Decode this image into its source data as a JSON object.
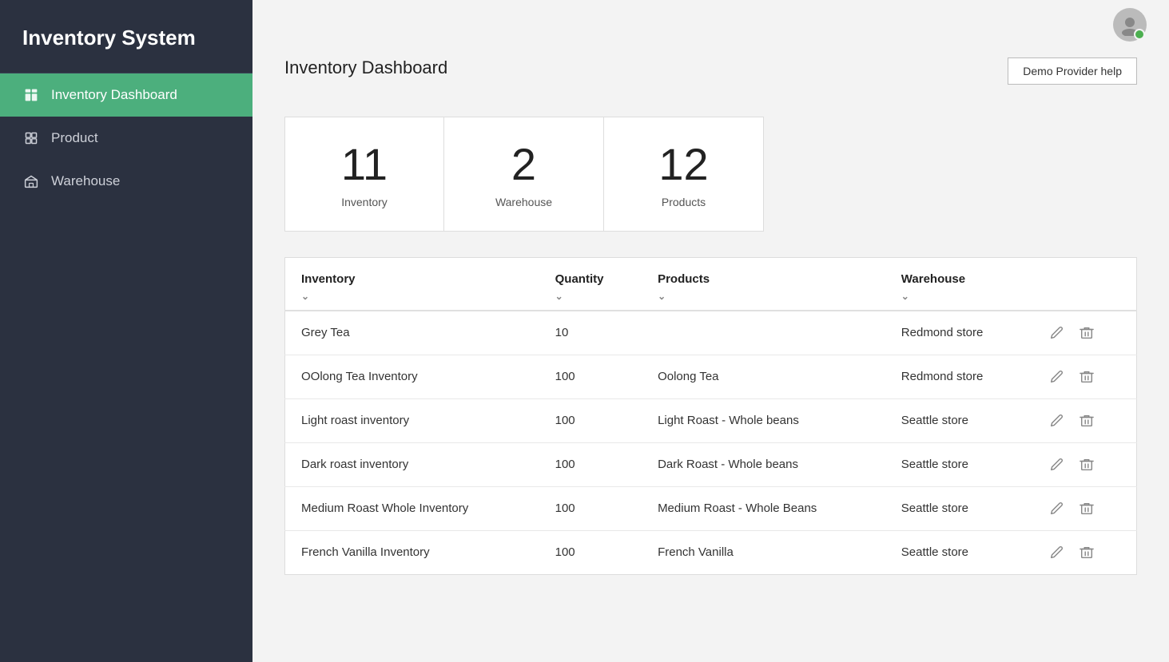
{
  "sidebar": {
    "title": "Inventory System",
    "items": [
      {
        "id": "inventory-dashboard",
        "label": "Inventory Dashboard",
        "icon": "dashboard-icon",
        "active": true
      },
      {
        "id": "product",
        "label": "Product",
        "icon": "product-icon",
        "active": false
      },
      {
        "id": "warehouse",
        "label": "Warehouse",
        "icon": "warehouse-icon",
        "active": false
      }
    ]
  },
  "header": {
    "page_title": "Inventory Dashboard",
    "demo_help_label": "Demo Provider help"
  },
  "stats": [
    {
      "number": "11",
      "label": "Inventory"
    },
    {
      "number": "2",
      "label": "Warehouse"
    },
    {
      "number": "12",
      "label": "Products"
    }
  ],
  "table": {
    "columns": [
      {
        "id": "inventory",
        "label": "Inventory",
        "sortable": true
      },
      {
        "id": "quantity",
        "label": "Quantity",
        "sortable": true
      },
      {
        "id": "products",
        "label": "Products",
        "sortable": true
      },
      {
        "id": "warehouse",
        "label": "Warehouse",
        "sortable": true
      }
    ],
    "rows": [
      {
        "inventory": "Grey Tea",
        "quantity": "10",
        "products": "",
        "warehouse": "Redmond store"
      },
      {
        "inventory": "OOlong Tea Inventory",
        "quantity": "100",
        "products": "Oolong Tea",
        "warehouse": "Redmond store"
      },
      {
        "inventory": "Light roast inventory",
        "quantity": "100",
        "products": "Light Roast - Whole beans",
        "warehouse": "Seattle store"
      },
      {
        "inventory": "Dark roast inventory",
        "quantity": "100",
        "products": "Dark Roast - Whole beans",
        "warehouse": "Seattle store"
      },
      {
        "inventory": "Medium Roast Whole Inventory",
        "quantity": "100",
        "products": "Medium Roast - Whole Beans",
        "warehouse": "Seattle store"
      },
      {
        "inventory": "French Vanilla Inventory",
        "quantity": "100",
        "products": "French Vanilla",
        "warehouse": "Seattle store"
      }
    ]
  }
}
